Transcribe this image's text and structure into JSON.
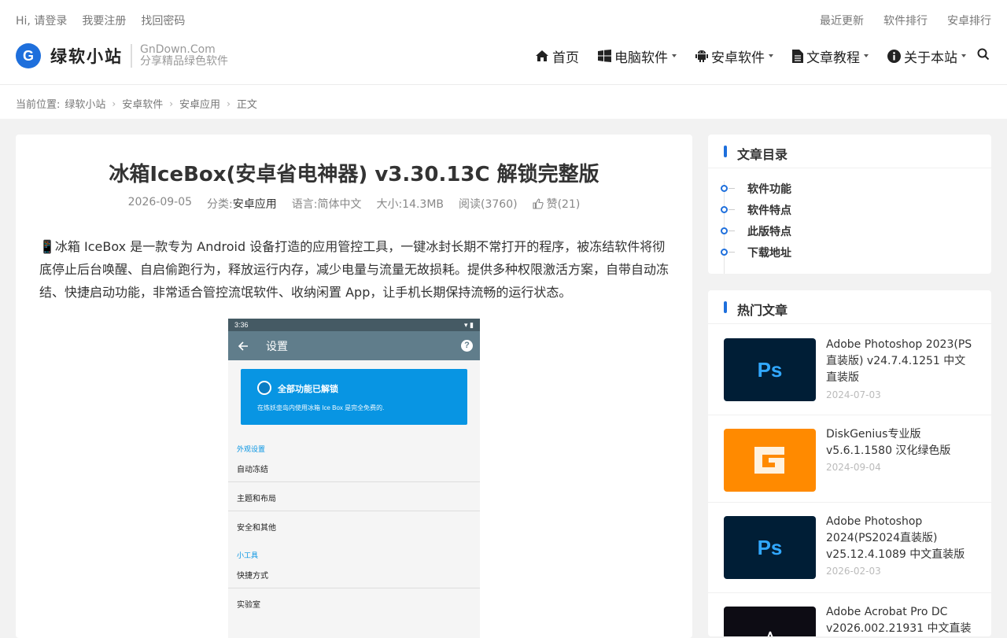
{
  "topbar": {
    "left": [
      "Hi, 请登录",
      "我要注册",
      "找回密码"
    ],
    "right": [
      "最近更新",
      "软件排行",
      "安卓排行"
    ]
  },
  "logo": {
    "letter": "G",
    "name": "绿软小站",
    "domain": "GnDown.Com",
    "slogan": "分享精品绿色软件"
  },
  "nav": [
    {
      "label": "首页",
      "icon": "home-icon",
      "dropdown": false
    },
    {
      "label": "电脑软件",
      "icon": "windows-icon",
      "dropdown": true
    },
    {
      "label": "安卓软件",
      "icon": "android-icon",
      "dropdown": true
    },
    {
      "label": "文章教程",
      "icon": "document-icon",
      "dropdown": true
    },
    {
      "label": "关于本站",
      "icon": "info-icon",
      "dropdown": true
    }
  ],
  "breadcrumb": {
    "prefix": "当前位置:",
    "items": [
      "绿软小站",
      "安卓软件",
      "安卓应用",
      "正文"
    ]
  },
  "article": {
    "title": "冰箱IceBox(安卓省电神器) v3.30.13C 解锁完整版",
    "date": "2026-09-05",
    "category_label": "分类:",
    "category": "安卓应用",
    "language": "语言:简体中文",
    "size": "大小:14.3MB",
    "reads": "阅读(3760)",
    "likes": "赞(21)",
    "intro": "📱冰箱 IceBox 是一款专为 Android 设备打造的应用管控工具，一键冰封长期不常打开的程序，被冻结软件将彻底停止后台唤醒、自启偷跑行为，释放运行内存，减少电量与流量无故损耗。提供多种权限激活方案，自带自动冻结、快捷启动功能，非常适合管控流氓软件、收纳闲置 App，让手机长期保持流畅的运行状态。"
  },
  "screenshot": {
    "time": "3:36",
    "toolbar_title": "设置",
    "help": "?",
    "banner_title": "全部功能已解锁",
    "banner_sub": "在炼妖壶岛内使用冰箱 Ice Box 是完全免费的.",
    "section1": "外观设置",
    "rows1": [
      "自动冻结",
      "主题和布局",
      "安全和其他"
    ],
    "section2": "小工具",
    "rows2": [
      "快捷方式",
      "实验室"
    ]
  },
  "sidebar": {
    "toc_title": "文章目录",
    "toc": [
      "软件功能",
      "软件特点",
      "此版特点",
      "下载地址"
    ],
    "hot_title": "热门文章",
    "hot": [
      {
        "title": "Adobe Photoshop 2023(PS直装版) v24.7.4.1251 中文直装版",
        "date": "2024-07-03",
        "thumb": "Ps"
      },
      {
        "title": "DiskGenius专业版 v5.6.1.1580 汉化绿色版",
        "date": "2024-09-04",
        "thumb": ""
      },
      {
        "title": "Adobe Photoshop 2024(PS2024直装版) v25.12.4.1089 中文直装版",
        "date": "2026-02-03",
        "thumb": "Ps"
      },
      {
        "title": "Adobe Acrobat Pro DC v2026.002.21931 中文直装版",
        "date": "",
        "thumb": ""
      }
    ]
  }
}
